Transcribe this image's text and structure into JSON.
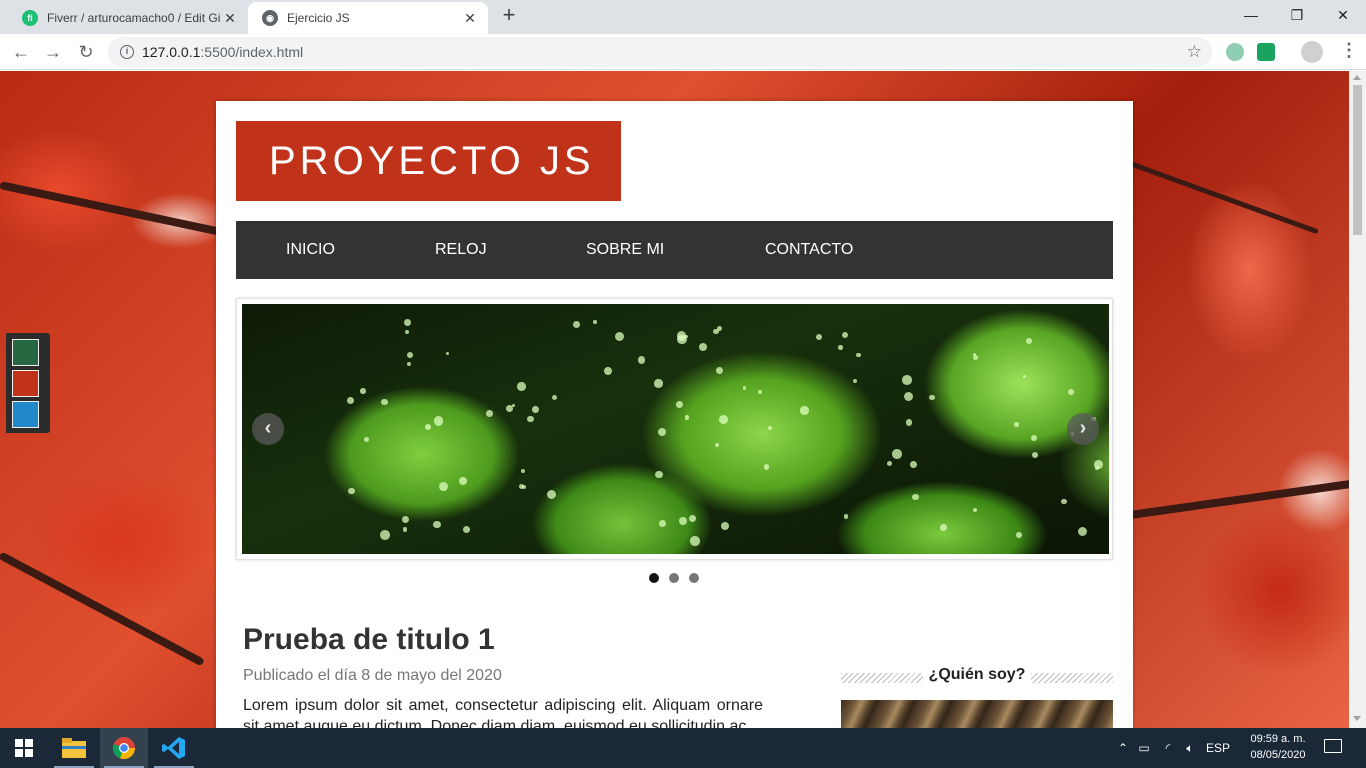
{
  "browser": {
    "tabs": [
      {
        "title": "Fiverr / arturocamacho0 / Edit Gi",
        "favicon": "fiverr-icon",
        "active": false
      },
      {
        "title": "Ejercicio JS",
        "favicon": "globe-icon",
        "active": true
      }
    ],
    "new_tab_glyph": "+",
    "url_host": "127.0.0.1",
    "url_rest": ":5500/index.html",
    "window_controls": {
      "minimize": "—",
      "restore": "❐",
      "close": "✕"
    }
  },
  "page": {
    "logo_text": "PROYECTO JS",
    "menu": [
      "INICIO",
      "RELOJ",
      "SOBRE MI",
      "CONTACTO"
    ],
    "theme_colors": [
      "#266842",
      "#c1321a",
      "#2189c9"
    ],
    "slider": {
      "dots": 3,
      "active_dot": 0,
      "prev_glyph": "‹",
      "next_glyph": "›"
    },
    "article": {
      "title": "Prueba de titulo 1",
      "date": "Publicado el día 8 de mayo del 2020",
      "body": "Lorem ipsum dolor sit amet, consectetur adipiscing elit. Aliquam ornare sit amet augue eu dictum. Donec diam diam, euismod eu sollicitudin ac"
    },
    "aside_title": "¿Quién soy?"
  },
  "taskbar": {
    "lang": "ESP",
    "time": "09:59 a. m.",
    "date": "08/05/2020"
  },
  "colors": {
    "brand_red": "#c1321a",
    "menu_bg": "#333333",
    "taskbar_bg": "#1b2838"
  }
}
